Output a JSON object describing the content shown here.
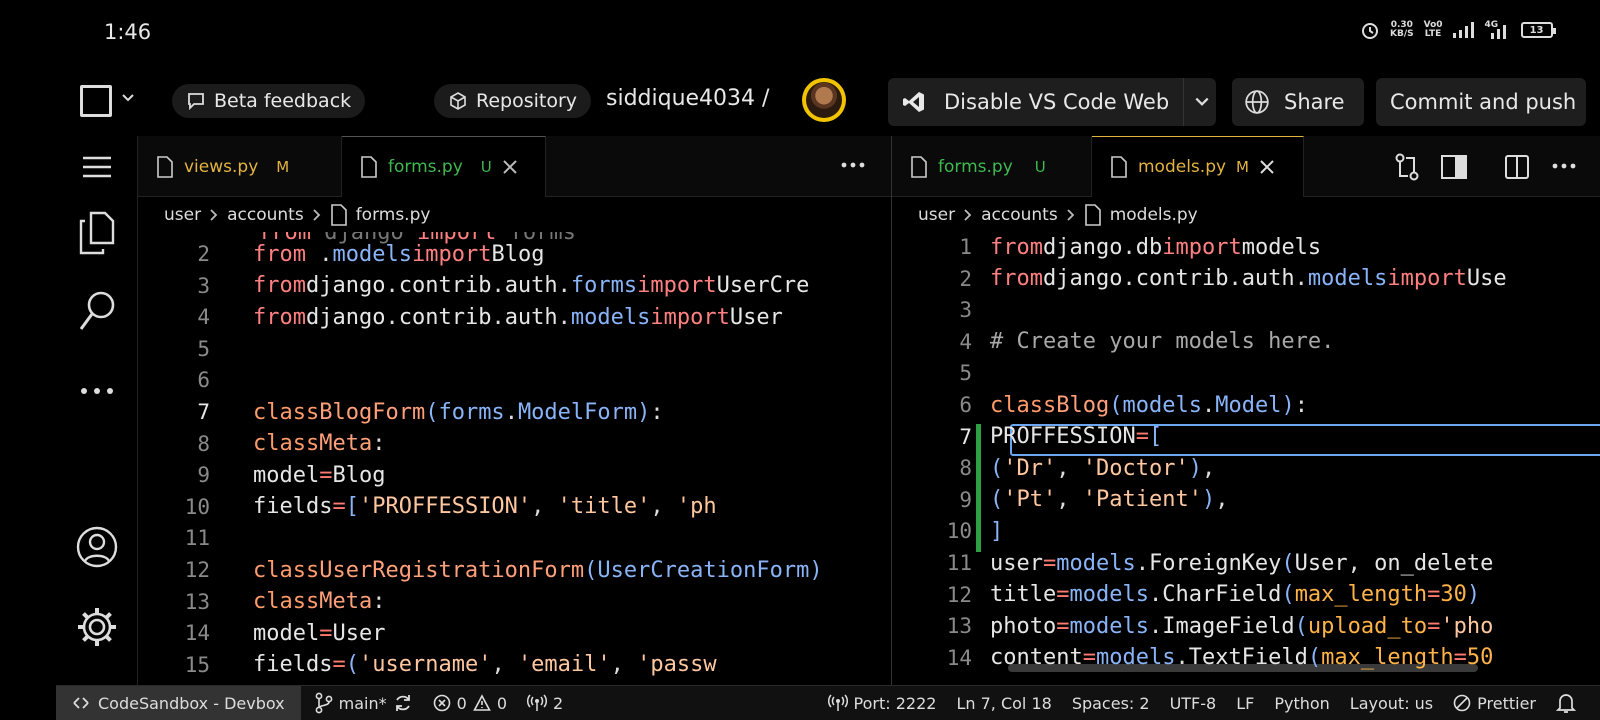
{
  "status": {
    "time": "1:46",
    "net_speed_top": "0.30",
    "net_speed_bottom": "KB/S",
    "volte_top": "Vo0",
    "volte_bottom": "LTE",
    "signal": "4G",
    "battery": "13"
  },
  "topbar": {
    "feedback": "Beta feedback",
    "repository": "Repository",
    "user": "siddique4034 /",
    "vscode": "Disable VS Code Web",
    "share": "Share",
    "commit": "Commit and push"
  },
  "left_editor": {
    "tabs": [
      {
        "name": "views.py",
        "badge": "M"
      },
      {
        "name": "forms.py",
        "badge": "U"
      }
    ],
    "breadcrumb": [
      "user",
      "accounts",
      "forms.py"
    ],
    "lines": [
      {
        "n": "2",
        "t": "from .models import Blog"
      },
      {
        "n": "3",
        "t": "from django.contrib.auth.forms import UserCre"
      },
      {
        "n": "4",
        "t": "from django.contrib.auth.models import User"
      },
      {
        "n": "5",
        "t": ""
      },
      {
        "n": "6",
        "t": ""
      },
      {
        "n": "7",
        "t": "class BlogForm(forms.ModelForm):"
      },
      {
        "n": "8",
        "t": "    class Meta:"
      },
      {
        "n": "9",
        "t": "        model = Blog"
      },
      {
        "n": "10",
        "t": "        fields = ['PROFFESSION', 'title', 'ph"
      },
      {
        "n": "11",
        "t": ""
      },
      {
        "n": "12",
        "t": "class UserRegistrationForm(UserCreationForm)"
      },
      {
        "n": "13",
        "t": "    class Meta:"
      },
      {
        "n": "14",
        "t": "        model = User"
      },
      {
        "n": "15",
        "t": "        fields = ('username', 'email', 'passw"
      }
    ]
  },
  "right_editor": {
    "tabs": [
      {
        "name": "forms.py",
        "badge": "U"
      },
      {
        "name": "models.py",
        "badge": "M"
      }
    ],
    "breadcrumb": [
      "user",
      "accounts",
      "models.py"
    ],
    "lines": [
      {
        "n": "1",
        "t": "from django.db import models"
      },
      {
        "n": "2",
        "t": "from django.contrib.auth.models import Use"
      },
      {
        "n": "3",
        "t": ""
      },
      {
        "n": "4",
        "t": "# Create your models here."
      },
      {
        "n": "5",
        "t": ""
      },
      {
        "n": "6",
        "t": "class Blog(models.Model):"
      },
      {
        "n": "7",
        "t": "  PROFFESSION = ["
      },
      {
        "n": "8",
        "t": "    ('Dr', 'Doctor'),"
      },
      {
        "n": "9",
        "t": "    ('Pt', 'Patient'),"
      },
      {
        "n": "10",
        "t": "  ]"
      },
      {
        "n": "11",
        "t": "  user = models.ForeignKey(User, on_delete"
      },
      {
        "n": "12",
        "t": "  title = models.CharField(max_length=30)"
      },
      {
        "n": "13",
        "t": "  photo = models.ImageField(upload_to='pho"
      },
      {
        "n": "14",
        "t": "  content = models.TextField(max_length=50"
      }
    ]
  },
  "footer": {
    "remote": "CodeSandbox - Devbox",
    "branch": "main*",
    "errors": "0",
    "warnings": "0",
    "ports_count": "2",
    "port": "Port: 2222",
    "position": "Ln 7, Col 18",
    "spaces": "Spaces: 2",
    "encoding": "UTF-8",
    "eol": "LF",
    "language": "Python",
    "layout": "Layout: us",
    "prettier": "Prettier"
  },
  "colors": {
    "modified": "#e2b340",
    "untracked": "#3fb950",
    "accent": "#58a6ff"
  }
}
